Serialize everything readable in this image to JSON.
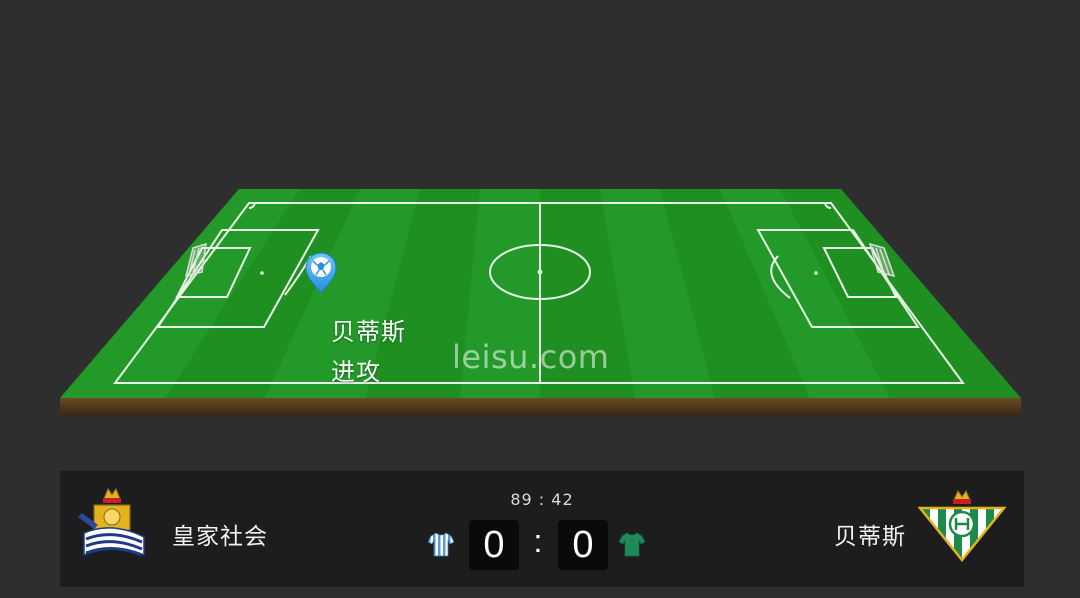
{
  "match": {
    "clock": "89 : 42",
    "home": {
      "name": "皇家社会",
      "score": "0",
      "crest_icon": "real-sociedad-crest-icon",
      "kit_icon": "striped-shirt-icon",
      "kit_color": "#8fb9e6"
    },
    "away": {
      "name": "贝蒂斯",
      "score": "0",
      "crest_icon": "real-betis-crest-icon",
      "kit_icon": "green-shirt-icon",
      "kit_color": "#1f8a55"
    },
    "separator": ":"
  },
  "event": {
    "team": "贝蒂斯",
    "action": "进攻",
    "marker_icon": "ball-location-pin-icon"
  },
  "watermark": "leisu.com",
  "colors": {
    "background": "#2e2e2e",
    "scoreboard": "#1d1d1d",
    "pitch": "#1f8f22",
    "marker": "#3aa6e8"
  }
}
